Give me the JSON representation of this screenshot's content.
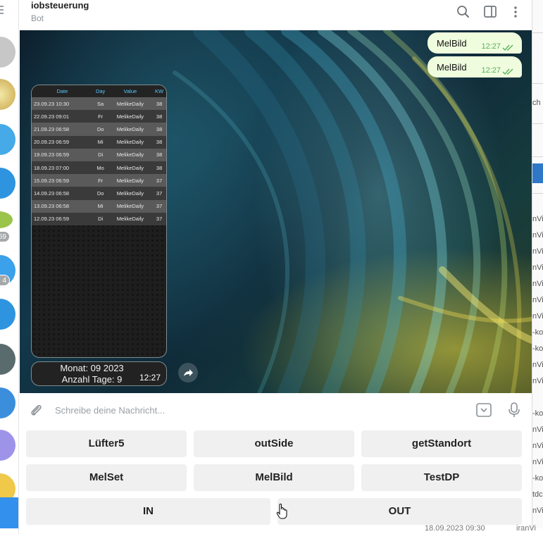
{
  "header": {
    "title": "iobsteuerung",
    "subtitle": "Bot"
  },
  "left_sidebar": {
    "badges": [
      "59",
      "4"
    ]
  },
  "messages": {
    "outgoing": [
      {
        "text": "MelBild",
        "time": "12:27"
      },
      {
        "text": "MelBild",
        "time": "12:27"
      }
    ],
    "image_table": {
      "columns": [
        "Date",
        "Day",
        "Value",
        "KW"
      ],
      "rows": [
        [
          "23.09.23 10:30",
          "Sa",
          "MelikeDaily",
          "38"
        ],
        [
          "22.09.23 09:01",
          "Fr",
          "MelikeDaily",
          "38"
        ],
        [
          "21.09.23 06:58",
          "Do",
          "MelikeDaily",
          "38"
        ],
        [
          "20.09.23 06:59",
          "Mi",
          "MelikeDaily",
          "38"
        ],
        [
          "19.09.23 06:59",
          "Di",
          "MelikeDaily",
          "38"
        ],
        [
          "18.09.23 07:00",
          "Mo",
          "MelikeDaily",
          "38"
        ],
        [
          "15.09.23 06:59",
          "Fr",
          "MelikeDaily",
          "37"
        ],
        [
          "14.09.23 06:58",
          "Do",
          "MelikeDaily",
          "37"
        ],
        [
          "13.09.23 06:58",
          "Mi",
          "MelikeDaily",
          "37"
        ],
        [
          "12.09.23 06:59",
          "Di",
          "MelikeDaily",
          "37"
        ]
      ]
    },
    "caption": {
      "line1": "Monat: 09 2023",
      "line2": "Anzahl Tage: 9",
      "time": "12:27"
    }
  },
  "composer": {
    "placeholder": "Schreibe deine Nachricht..."
  },
  "keyboard": {
    "rows": [
      [
        "Lüfter5",
        "outSide",
        "getStandort"
      ],
      [
        "MelSet",
        "MelBild",
        "TestDP"
      ],
      [
        "IN",
        "OUT"
      ]
    ]
  },
  "background_window": {
    "rows": [
      "ch r",
      "nVi",
      "nVi",
      "nVi",
      "nVi",
      "nVi",
      "nVi",
      "nVi",
      "-ko",
      "-ko",
      "nVi",
      "nVi",
      "-ko",
      "nVi",
      "nVi",
      "nVi",
      "-ko",
      "tdc",
      "nVi"
    ],
    "footer_date": "18.09.2023 09:30",
    "footer_text": "iranVi"
  },
  "colors": {
    "accent": "#3390ec",
    "outgoing_bubble": "#effdde",
    "keyboard_button": "#f0f0f0",
    "table_header_text": "#55c8ff"
  },
  "icons": {
    "search": "search-icon",
    "sidebar_toggle": "sidebar-toggle-icon",
    "more": "more-vertical-icon",
    "attach": "paperclip-icon",
    "bot_keyboard": "bot-keyboard-icon",
    "microphone": "microphone-icon",
    "forward": "forward-icon",
    "read_receipt": "double-check-icon"
  }
}
